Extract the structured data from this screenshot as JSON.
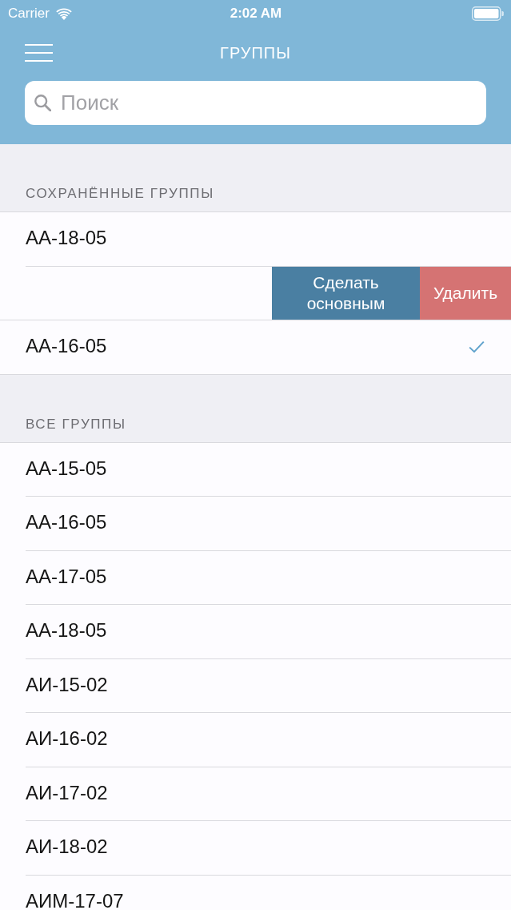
{
  "status_bar": {
    "carrier": "Carrier",
    "time": "2:02 AM"
  },
  "nav_bar": {
    "title": "ГРУППЫ"
  },
  "search": {
    "placeholder": "Поиск"
  },
  "sections": [
    {
      "title": "СОХРАНЁННЫЕ ГРУППЫ",
      "rows": [
        {
          "kind": "group",
          "label": "АА-18-05",
          "checked": false
        },
        {
          "kind": "swiped",
          "actions": [
            {
              "kind": "normal",
              "label": "Сделать основным"
            },
            {
              "kind": "destructive",
              "label": "Удалить"
            }
          ]
        },
        {
          "kind": "group",
          "label": "АА-16-05",
          "checked": true
        }
      ]
    },
    {
      "title": "ВСЕ ГРУППЫ",
      "rows": [
        {
          "kind": "group",
          "label": "АА-15-05"
        },
        {
          "kind": "group",
          "label": "АА-16-05"
        },
        {
          "kind": "group",
          "label": "АА-17-05"
        },
        {
          "kind": "group",
          "label": "АА-18-05"
        },
        {
          "kind": "group",
          "label": "АИ-15-02"
        },
        {
          "kind": "group",
          "label": "АИ-16-02"
        },
        {
          "kind": "group",
          "label": "АИ-17-02"
        },
        {
          "kind": "group",
          "label": "АИ-18-02"
        },
        {
          "kind": "group",
          "label": "АИМ-17-07"
        }
      ]
    }
  ]
}
